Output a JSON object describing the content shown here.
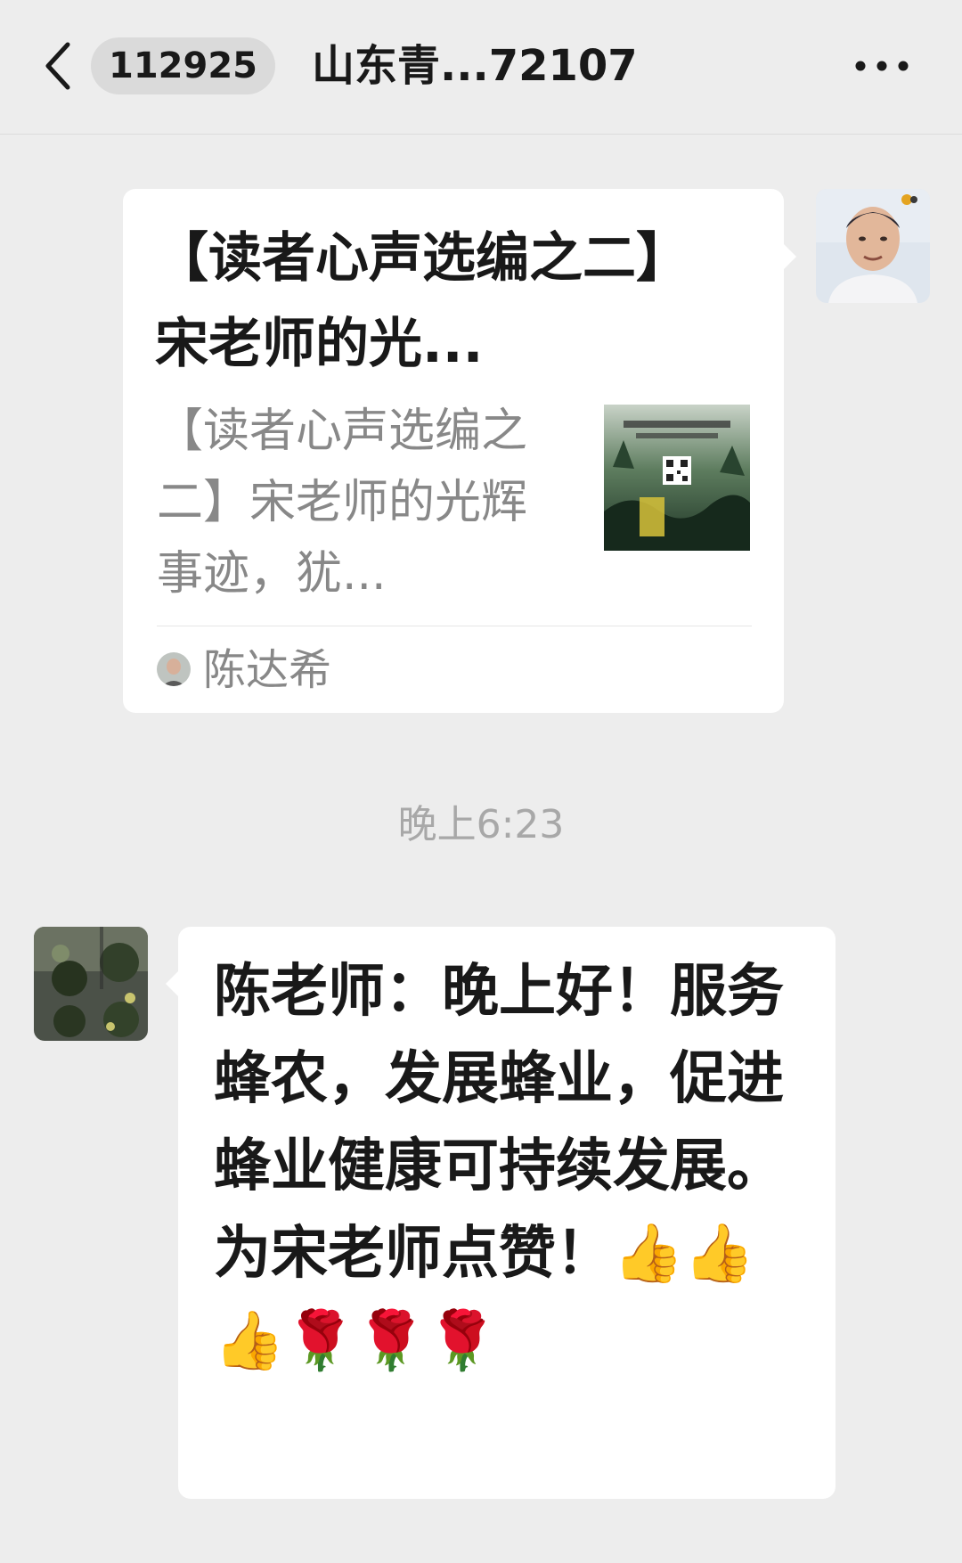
{
  "header": {
    "unread_count": "112925",
    "title": "山东青...72107"
  },
  "article_card": {
    "title": "【读者心声选编之二】宋老师的光...",
    "description": "【读者心声选编之二】宋老师的光辉事迹，犹...",
    "source_name": "陈达希"
  },
  "timestamp": "晚上6:23",
  "message": {
    "text": "陈老师：晚上好！服务蜂农，发展蜂业，促进蜂业健康可持续发展。为宋老师点赞！👍👍👍🌹🌹🌹"
  },
  "icons": {
    "back": "chevron-left-icon",
    "more": "more-dots-icon"
  },
  "colors": {
    "background": "#ededed",
    "bubble": "#ffffff",
    "secondary_text": "#888888"
  }
}
